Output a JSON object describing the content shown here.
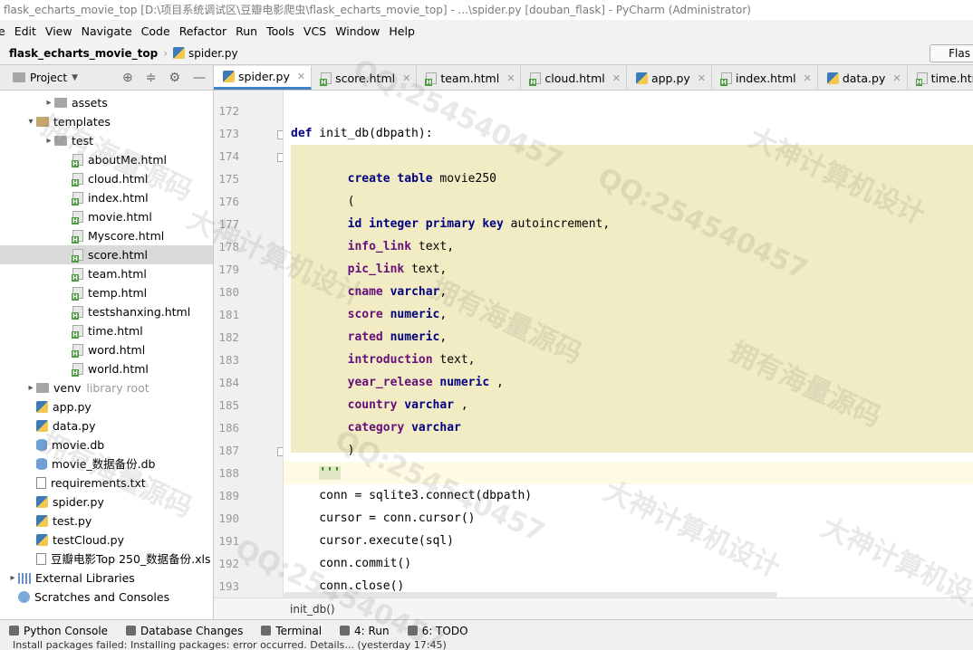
{
  "window": {
    "title": "flask_echarts_movie_top [D:\\项目系统调试区\\豆瓣电影爬虫\\flask_echarts_movie_top] - ...\\spider.py [douban_flask] - PyCharm (Administrator)"
  },
  "menu": [
    "e",
    "Edit",
    "View",
    "Navigate",
    "Code",
    "Refactor",
    "Run",
    "Tools",
    "VCS",
    "Window",
    "Help"
  ],
  "navbar": {
    "project": "flask_echarts_movie_top",
    "file": "spider.py",
    "run_config": "Flas"
  },
  "project_panel": {
    "title": "Project",
    "tree": [
      {
        "label": "assets",
        "icon": "folder-icon",
        "indent": 2,
        "arrow": "collapsed"
      },
      {
        "label": "templates",
        "icon": "folder-icon",
        "indent": 1,
        "arrow": "expanded"
      },
      {
        "label": "test",
        "icon": "folder-icon",
        "indent": 2,
        "arrow": "collapsed"
      },
      {
        "label": "aboutMe.html",
        "icon": "html-file-icon",
        "indent": 3
      },
      {
        "label": "cloud.html",
        "icon": "html-file-icon",
        "indent": 3
      },
      {
        "label": "index.html",
        "icon": "html-file-icon",
        "indent": 3
      },
      {
        "label": "movie.html",
        "icon": "html-file-icon",
        "indent": 3
      },
      {
        "label": "Myscore.html",
        "icon": "html-file-icon",
        "indent": 3
      },
      {
        "label": "score.html",
        "icon": "html-file-icon",
        "indent": 3,
        "selected": true
      },
      {
        "label": "team.html",
        "icon": "html-file-icon",
        "indent": 3
      },
      {
        "label": "temp.html",
        "icon": "html-file-icon",
        "indent": 3
      },
      {
        "label": "testshanxing.html",
        "icon": "html-file-icon",
        "indent": 3
      },
      {
        "label": "time.html",
        "icon": "html-file-icon",
        "indent": 3
      },
      {
        "label": "word.html",
        "icon": "html-file-icon",
        "indent": 3
      },
      {
        "label": "world.html",
        "icon": "html-file-icon",
        "indent": 3
      },
      {
        "label": "venv",
        "icon": "folder-icon",
        "indent": 1,
        "arrow": "collapsed",
        "suffix": "library root"
      },
      {
        "label": "app.py",
        "icon": "python-file-icon",
        "indent": 1
      },
      {
        "label": "data.py",
        "icon": "python-file-icon",
        "indent": 1
      },
      {
        "label": "movie.db",
        "icon": "database-icon",
        "indent": 1
      },
      {
        "label": "movie_数据备份.db",
        "icon": "database-icon",
        "indent": 1
      },
      {
        "label": "requirements.txt",
        "icon": "text-file-icon",
        "indent": 1
      },
      {
        "label": "spider.py",
        "icon": "python-file-icon",
        "indent": 1
      },
      {
        "label": "test.py",
        "icon": "python-file-icon",
        "indent": 1
      },
      {
        "label": "testCloud.py",
        "icon": "python-file-icon",
        "indent": 1
      },
      {
        "label": "豆瓣电影Top 250_数据备份.xls",
        "icon": "excel-file-icon",
        "indent": 1
      },
      {
        "label": "External Libraries",
        "icon": "library-icon",
        "indent": 0,
        "arrow": "collapsed"
      },
      {
        "label": "Scratches and Consoles",
        "icon": "scratch-icon",
        "indent": 0
      }
    ]
  },
  "tabs": [
    {
      "label": "spider.py",
      "icon": "python-file-icon",
      "active": true
    },
    {
      "label": "score.html",
      "icon": "html-file-icon"
    },
    {
      "label": "team.html",
      "icon": "html-file-icon"
    },
    {
      "label": "cloud.html",
      "icon": "html-file-icon"
    },
    {
      "label": "app.py",
      "icon": "python-file-icon"
    },
    {
      "label": "index.html",
      "icon": "html-file-icon"
    },
    {
      "label": "data.py",
      "icon": "python-file-icon"
    },
    {
      "label": "time.html",
      "icon": "html-file-icon"
    }
  ],
  "editor": {
    "line_numbers": [
      "172",
      "173",
      "174",
      "175",
      "176",
      "177",
      "178",
      "179",
      "180",
      "181",
      "182",
      "183",
      "184",
      "185",
      "186",
      "187",
      "188",
      "189",
      "190",
      "191",
      "192",
      "193"
    ],
    "breadcrumb": "init_db()"
  },
  "toolwindows": [
    {
      "label": "Python Console",
      "icon": "python-console-icon"
    },
    {
      "label": "Database Changes",
      "icon": "database-changes-icon"
    },
    {
      "label": "Terminal",
      "icon": "terminal-icon"
    },
    {
      "label": "4: Run",
      "icon": "run-icon"
    },
    {
      "label": "6: TODO",
      "icon": "todo-icon"
    }
  ],
  "status": "Install packages failed: Installing packages: error occurred. Details... (yesterday 17:45)",
  "watermarks": [
    "拥有海量源码",
    "QQ:254540457",
    "大神计算机设计"
  ]
}
